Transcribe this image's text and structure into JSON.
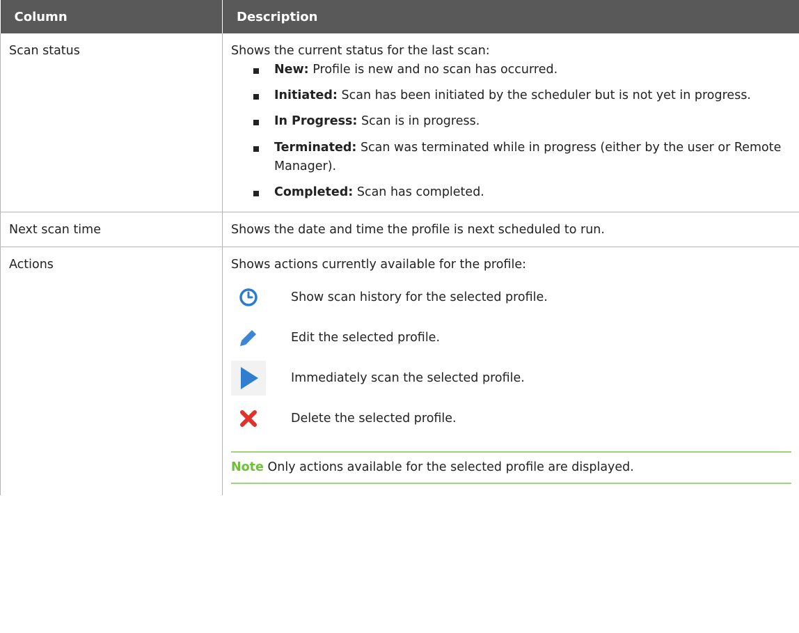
{
  "table": {
    "headers": [
      "Column",
      "Description"
    ],
    "rows": {
      "scan_status": {
        "column": "Scan status",
        "intro": "Shows the current status for the last scan:",
        "items": [
          {
            "term": "New:",
            "desc": "Profile is new and no scan has occurred."
          },
          {
            "term": "Initiated:",
            "desc": "Scan has been initiated by the scheduler but is not yet in progress."
          },
          {
            "term": "In Progress:",
            "desc": "Scan is in progress."
          },
          {
            "term": "Terminated:",
            "desc": "Scan was terminated while in progress (either by the user or Remote Manager)."
          },
          {
            "term": "Completed:",
            "desc": "Scan has completed."
          }
        ]
      },
      "next_scan_time": {
        "column": "Next scan time",
        "desc": "Shows the date and time the profile is next scheduled to run."
      },
      "actions": {
        "column": "Actions",
        "intro": "Shows actions currently available for the profile:",
        "items": [
          {
            "icon": "clock-icon",
            "desc": "Show scan history for the selected profile."
          },
          {
            "icon": "pencil-icon",
            "desc": "Edit the selected profile."
          },
          {
            "icon": "play-icon",
            "desc": "Immediately scan the selected profile."
          },
          {
            "icon": "delete-x-icon",
            "desc": "Delete the selected profile."
          }
        ],
        "note_label": "Note",
        "note_text": "Only actions available for the selected profile are displayed."
      }
    }
  },
  "colors": {
    "header_bg": "#595959",
    "note_accent": "#6fbf3a",
    "icon_blue": "#2b7bd0",
    "delete_red": "#e0322b"
  }
}
